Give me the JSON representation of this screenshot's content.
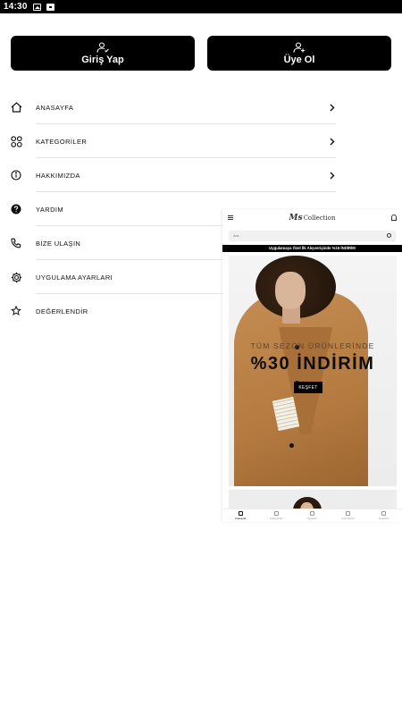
{
  "status_bar": {
    "time": "14:30"
  },
  "auth": {
    "login_label": "Giriş Yap",
    "signup_label": "Üye Ol"
  },
  "menu": {
    "items": [
      {
        "label": "ANASAYFA",
        "icon": "home-icon",
        "has_chevron": true
      },
      {
        "label": "KATEGORİLER",
        "icon": "grid-icon",
        "has_chevron": true
      },
      {
        "label": "HAKKIMIZDA",
        "icon": "info-icon",
        "has_chevron": true
      },
      {
        "label": "YARDIM",
        "icon": "help-icon",
        "has_chevron": true
      },
      {
        "label": "BİZE ULAŞIN",
        "icon": "phone-icon",
        "has_chevron": false
      },
      {
        "label": "UYGULAMA AYARLARI",
        "icon": "gear-icon",
        "has_chevron": false
      },
      {
        "label": "DEĞERLENDİR",
        "icon": "star-icon",
        "has_chevron": false
      }
    ]
  },
  "preview": {
    "logo_mark": "Ms",
    "logo_text": "Collection",
    "search_placeholder": "Ara...",
    "promo_banner": "Uygulamaya Özel İlk Alışverişinde %15 İNDİRİM",
    "hero_subtitle": "TÜM SEZON ÜRÜNLERİNDE",
    "hero_title": "%30 İNDİRİM",
    "hero_button": "KEŞFET",
    "tabs": [
      {
        "label": "Anasayfa",
        "active": true
      },
      {
        "label": "Kategoriler",
        "active": false
      },
      {
        "label": "Sepetim",
        "active": false
      },
      {
        "label": "Favorilerim",
        "active": false
      },
      {
        "label": "Hesabım",
        "active": false
      }
    ]
  },
  "colors": {
    "button_bg": "#000000",
    "button_text": "#ffffff",
    "divider": "#e4e4e4",
    "coat": "#b47a40"
  }
}
